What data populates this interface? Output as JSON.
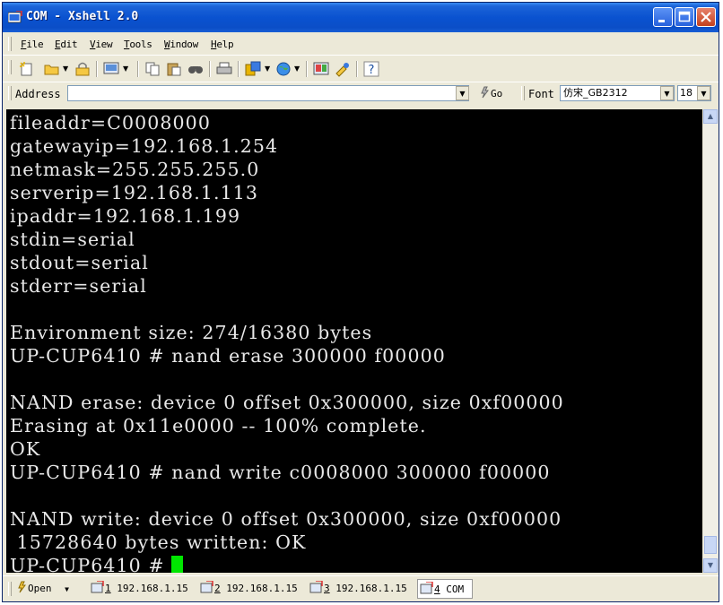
{
  "window": {
    "title": "COM - Xshell 2.0"
  },
  "menu": [
    "File",
    "Edit",
    "View",
    "Tools",
    "Window",
    "Help"
  ],
  "address": {
    "label": "Address",
    "value": "",
    "go_label": "Go"
  },
  "font": {
    "label": "Font",
    "name": "仿宋_GB2312",
    "size": "18"
  },
  "terminal": {
    "lines": [
      "fileaddr=C0008000",
      "gatewayip=192.168.1.254",
      "netmask=255.255.255.0",
      "serverip=192.168.1.113",
      "ipaddr=192.168.1.199",
      "stdin=serial",
      "stdout=serial",
      "stderr=serial",
      "",
      "Environment size: 274/16380 bytes",
      "UP-CUP6410 # nand erase 300000 f00000",
      "",
      "NAND erase: device 0 offset 0x300000, size 0xf00000",
      "Erasing at 0x11e0000 -- 100% complete.",
      "OK",
      "UP-CUP6410 # nand write c0008000 300000 f00000",
      "",
      "NAND write: device 0 offset 0x300000, size 0xf00000",
      " 15728640 bytes written: OK",
      "UP-CUP6410 # "
    ]
  },
  "tabs": {
    "open_label": "Open",
    "items": [
      {
        "num": "1",
        "label": " 192.168.1.15"
      },
      {
        "num": "2",
        "label": " 192.168.1.15"
      },
      {
        "num": "3",
        "label": " 192.168.1.15"
      },
      {
        "num": "4",
        "label": " COM"
      }
    ]
  },
  "colors": {
    "terminal_bg": "#000000",
    "terminal_fg": "#e8e8e8",
    "cursor": "#00e600",
    "titlebar": "#0a52d0"
  },
  "icons": [
    "new-session-icon",
    "open-folder-icon",
    "lock-icon",
    "screen-icon",
    "copy-icon",
    "paste-icon",
    "find-icon",
    "print-icon",
    "sftp-icon",
    "globe-icon",
    "settings-icon",
    "tools-icon",
    "help-icon",
    "go-icon",
    "session-icon"
  ]
}
